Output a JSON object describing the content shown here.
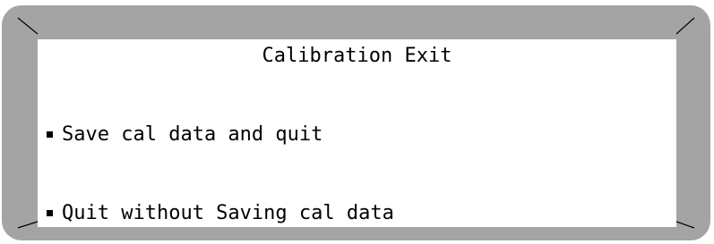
{
  "screen": {
    "title": "Calibration Exit",
    "menu_items": [
      {
        "label": "Save cal data and quit"
      },
      {
        "label": "Quit without Saving cal data"
      }
    ]
  },
  "colors": {
    "bezel": "#a4a4a4",
    "screen_background": "#ffffff",
    "text": "#000000"
  }
}
